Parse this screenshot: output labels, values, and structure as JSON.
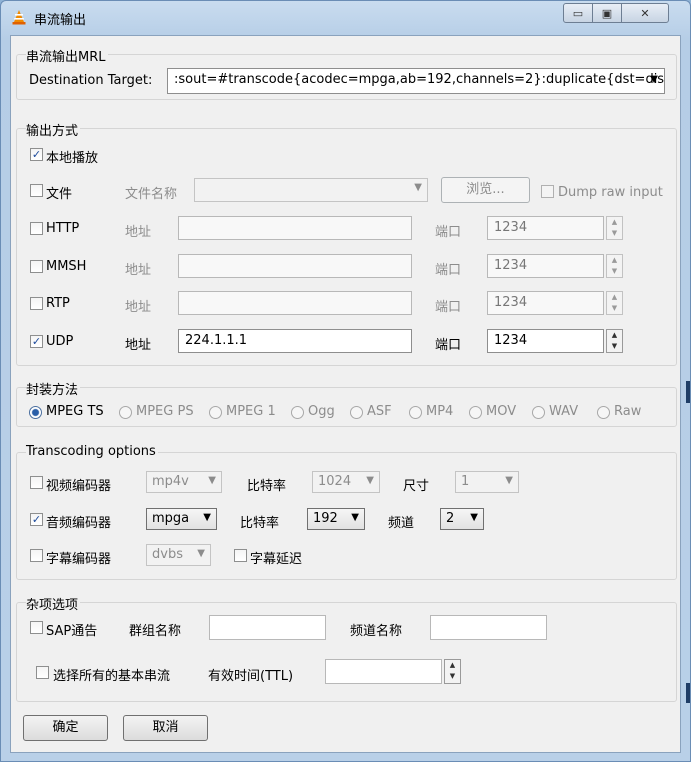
{
  "window": {
    "title": "串流输出",
    "minimize_glyph": "▭",
    "maximize_glyph": "▣",
    "close_glyph": "✕"
  },
  "mrl": {
    "group_label": "串流输出MRL",
    "destination_label": "Destination Target:",
    "destination_value": ":sout=#transcode{acodec=mpga,ab=192,channels=2}:duplicate{dst=dis"
  },
  "output": {
    "group_label": "输出方式",
    "local_play": {
      "label": "本地播放",
      "checked": true
    },
    "file": {
      "label": "文件",
      "name_label": "文件名称",
      "browse_label": "浏览...",
      "dump_raw_label": "Dump raw input"
    },
    "http": {
      "label": "HTTP",
      "addr_label": "地址",
      "port_label": "端口",
      "port_value": "1234"
    },
    "mmsh": {
      "label": "MMSH",
      "addr_label": "地址",
      "port_label": "端口",
      "port_value": "1234"
    },
    "rtp": {
      "label": "RTP",
      "addr_label": "地址",
      "port_label": "端口",
      "port_value": "1234"
    },
    "udp": {
      "label": "UDP",
      "addr_label": "地址",
      "addr_value": "224.1.1.1",
      "port_label": "端口",
      "port_value": "1234",
      "checked": true
    }
  },
  "encap": {
    "group_label": "封装方法",
    "options": [
      "MPEG TS",
      "MPEG PS",
      "MPEG 1",
      "Ogg",
      "ASF",
      "MP4",
      "MOV",
      "WAV",
      "Raw"
    ],
    "selected": "MPEG TS"
  },
  "transcode": {
    "group_label": "Transcoding options",
    "video": {
      "label": "视频编码器",
      "codec": "mp4v",
      "bitrate_label": "比特率",
      "bitrate": "1024",
      "size_label": "尺寸",
      "size": "1"
    },
    "audio": {
      "label": "音频编码器",
      "codec": "mpga",
      "bitrate_label": "比特率",
      "bitrate": "192",
      "channels_label": "频道",
      "channels": "2",
      "checked": true
    },
    "subtitle": {
      "label": "字幕编码器",
      "codec": "dvbs",
      "overlay_label": "字幕延迟"
    }
  },
  "misc": {
    "group_label": "杂项选项",
    "sap_label": "SAP通告",
    "group_name_label": "群组名称",
    "channel_name_label": "频道名称",
    "select_all_label": "选择所有的基本串流",
    "ttl_label": "有效时间(TTL)"
  },
  "buttons": {
    "ok": "确定",
    "cancel": "取消"
  },
  "colors": {
    "accent": "#2a5fa8",
    "window_frame": "#b9d0e8"
  },
  "icons": {
    "app": "vlc-cone-icon",
    "dropdown": "chevron-down-icon",
    "spin": "spin-arrows-icon",
    "check": "check-icon"
  }
}
